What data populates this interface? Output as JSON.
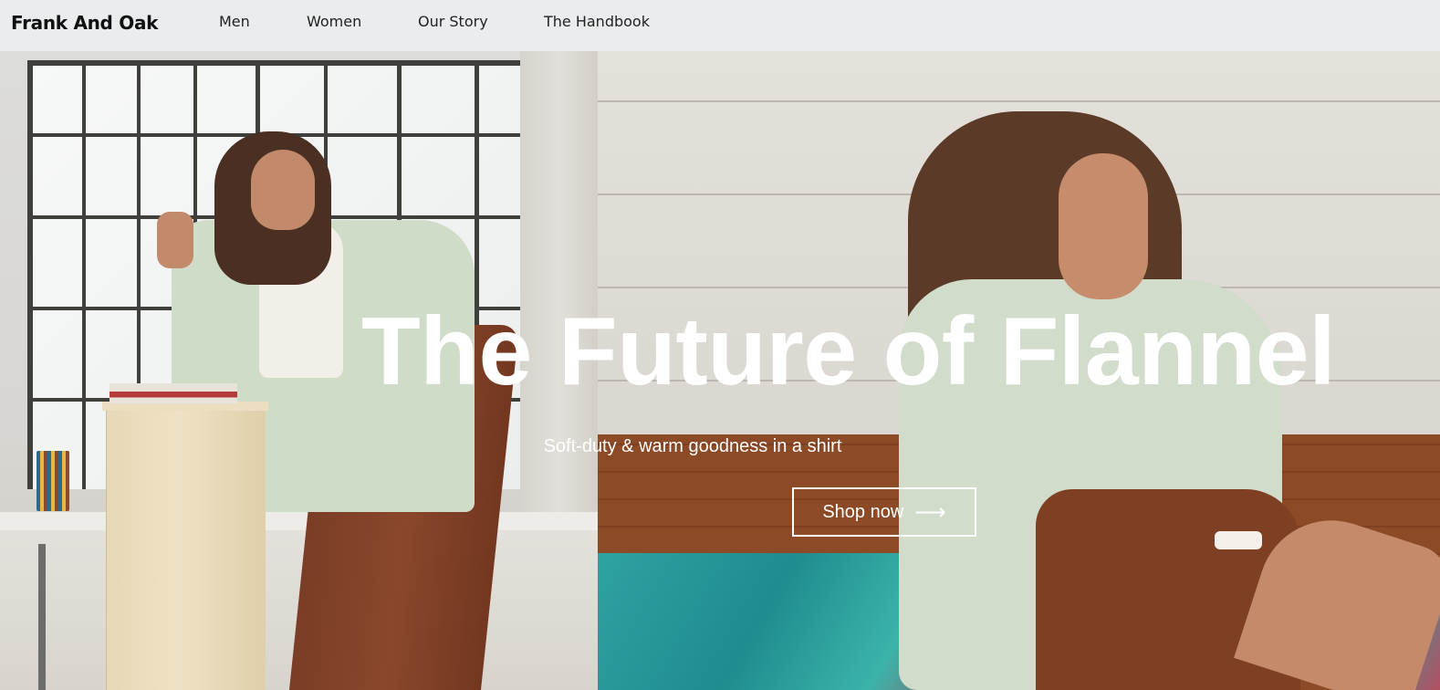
{
  "brand": {
    "name": "Frank And Oak"
  },
  "nav": {
    "items": [
      {
        "label": "Men"
      },
      {
        "label": "Women"
      },
      {
        "label": "Our Story"
      },
      {
        "label": "The Handbook"
      }
    ]
  },
  "hero": {
    "title": "The Future of Flannel",
    "subtitle": "Soft-duty & warm goodness in a shirt",
    "cta_label": "Shop now",
    "cta_icon": "arrow-right-icon"
  },
  "colors": {
    "nav_background": "#e9eded",
    "hero_text": "#ffffff",
    "brand_text": "#111111"
  }
}
